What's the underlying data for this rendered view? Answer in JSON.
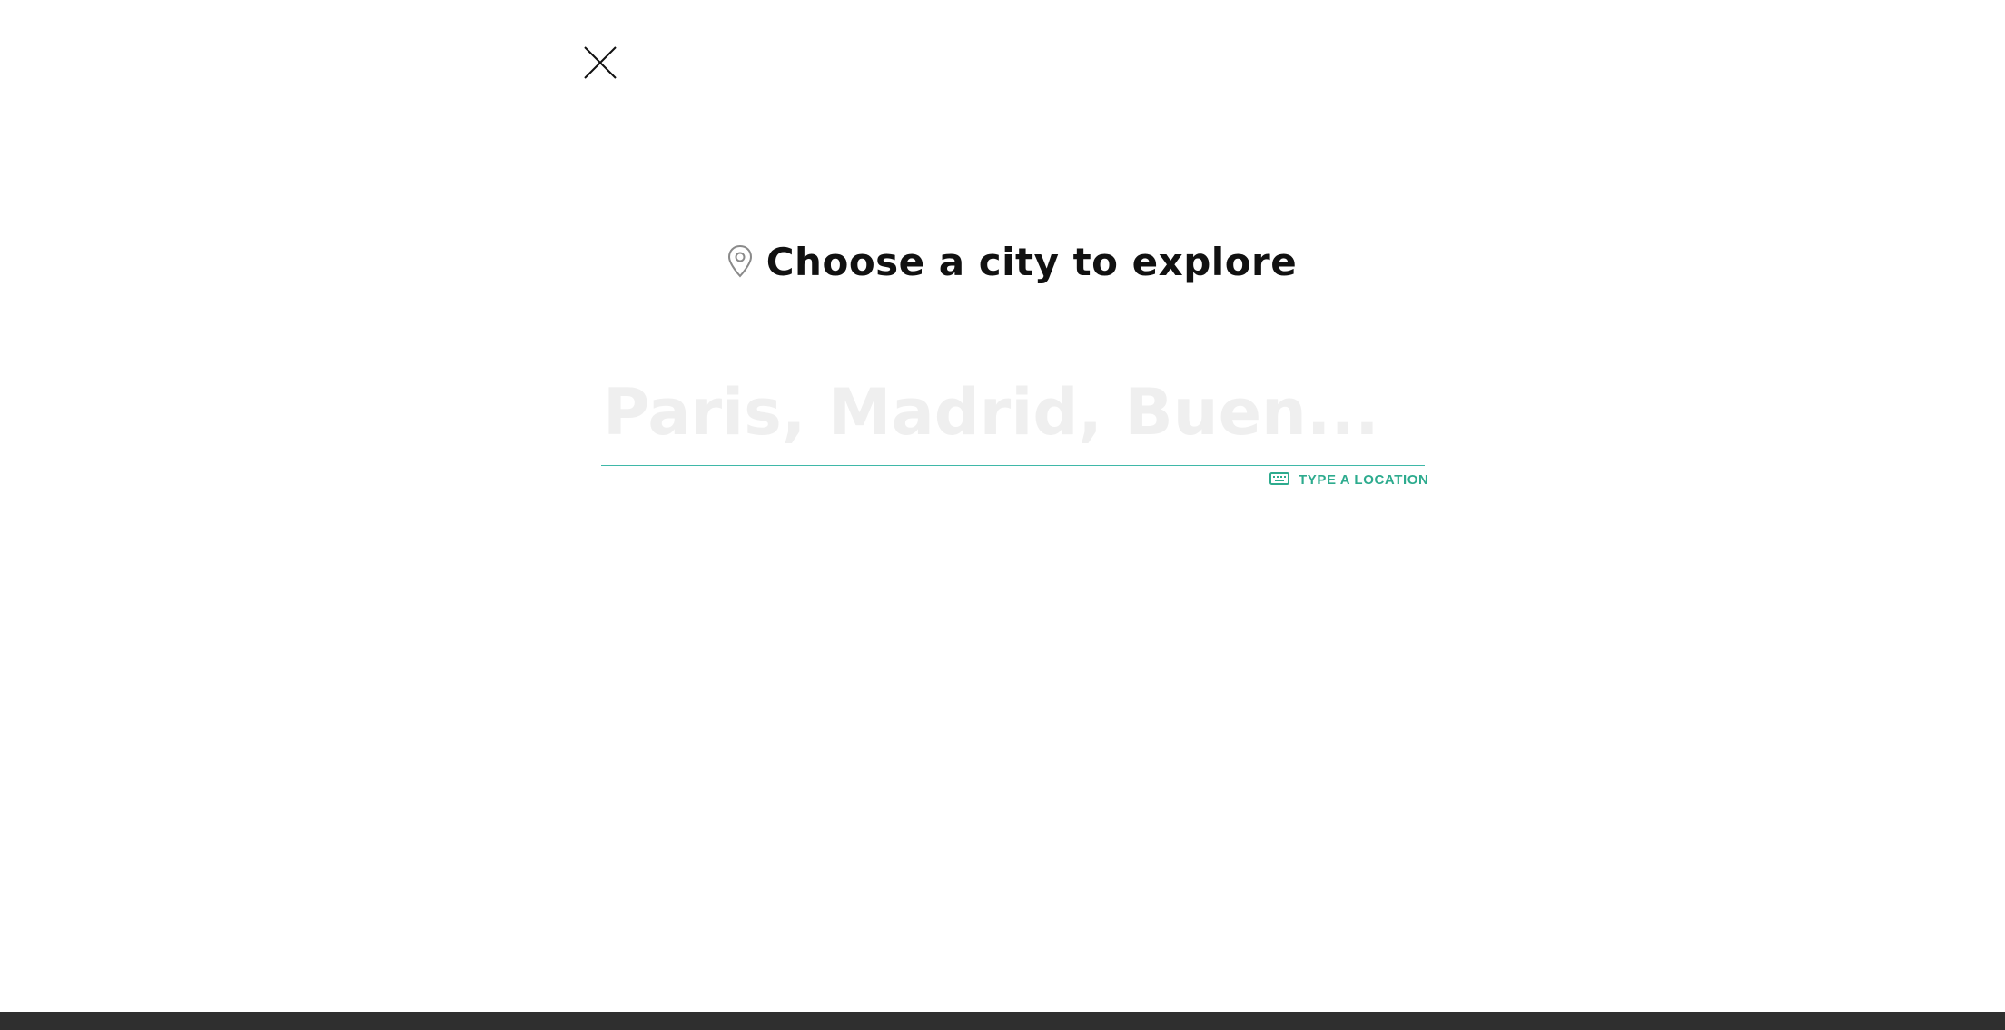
{
  "dialog": {
    "close_icon": "close-icon",
    "heading": {
      "icon": "map-pin-icon",
      "title": "Choose a city to explore"
    },
    "search": {
      "placeholder": "Paris, Madrid, Buen...",
      "value": ""
    },
    "type_location": {
      "icon": "keyboard-icon",
      "label": "TYPE A LOCATION"
    }
  },
  "colors": {
    "accent": "#2dab8e",
    "underline": "#3fb8a8",
    "title": "#111111",
    "placeholder": "#efefef",
    "footer": "#2f2f2f"
  }
}
